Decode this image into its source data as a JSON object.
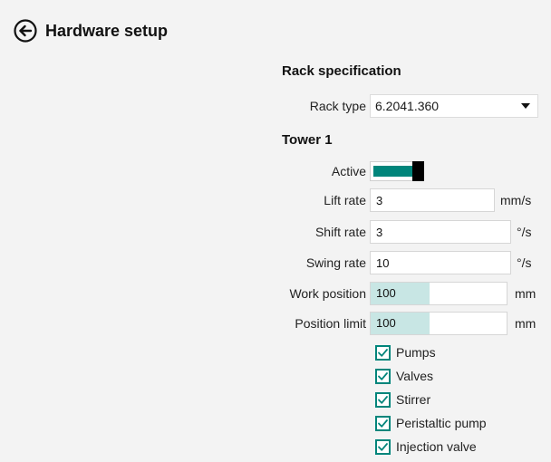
{
  "header": {
    "title": "Hardware setup",
    "back_icon": "back-arrow-icon"
  },
  "rack": {
    "section_title": "Rack specification",
    "rack_type_label": "Rack type",
    "rack_type_value": "6.2041.360"
  },
  "tower": {
    "section_title": "Tower 1",
    "active_label": "Active",
    "active_on": true,
    "lift_rate": {
      "label": "Lift rate",
      "value": "3",
      "unit": "mm/s"
    },
    "shift_rate": {
      "label": "Shift rate",
      "value": "3",
      "unit": "°/s"
    },
    "swing_rate": {
      "label": "Swing rate",
      "value": "10",
      "unit": "°/s"
    },
    "work_position": {
      "label": "Work position",
      "value": "100",
      "unit": "mm",
      "level_fraction": 0.43
    },
    "position_limit": {
      "label": "Position limit",
      "value": "100",
      "unit": "mm",
      "level_fraction": 0.43
    }
  },
  "options": [
    {
      "label": "Pumps",
      "checked": true
    },
    {
      "label": "Valves",
      "checked": true
    },
    {
      "label": "Stirrer",
      "checked": true
    },
    {
      "label": "Peristaltic pump",
      "checked": true
    },
    {
      "label": "Injection valve",
      "checked": true
    }
  ],
  "colors": {
    "accent": "#00857b",
    "progress_fill": "#c8e6e4",
    "background": "#f3f3f3"
  }
}
